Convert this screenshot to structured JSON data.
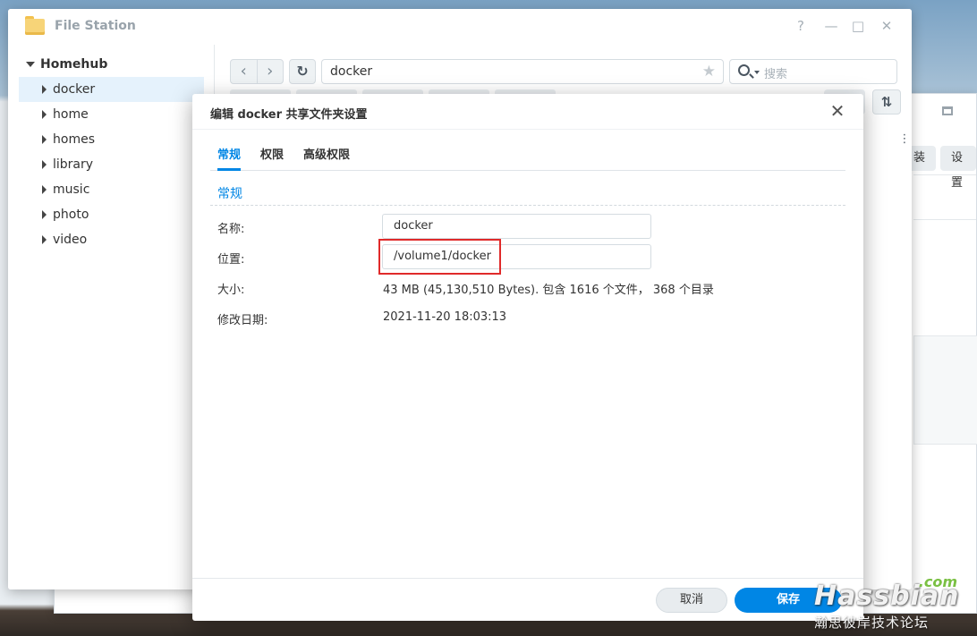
{
  "background_window": {
    "button_left": "装",
    "button_settings": "设置"
  },
  "file_station": {
    "title": "File Station",
    "window_controls": {
      "help": "?",
      "minimize": "—",
      "maximize": "□",
      "close": "✕"
    },
    "tree": {
      "root": "Homehub",
      "items": [
        {
          "label": "docker",
          "selected": true
        },
        {
          "label": "home"
        },
        {
          "label": "homes"
        },
        {
          "label": "library"
        },
        {
          "label": "music"
        },
        {
          "label": "photo"
        },
        {
          "label": "video"
        }
      ]
    },
    "toolbar": {
      "back": "‹",
      "forward": "›",
      "refresh": "↻",
      "path": "docker",
      "star": "★",
      "search_placeholder": "搜索",
      "sort": "⇅",
      "more": "⋮"
    }
  },
  "dialog": {
    "title": "编辑 docker 共享文件夹设置",
    "close": "✕",
    "tabs": [
      "常规",
      "权限",
      "高级权限"
    ],
    "active_tab": 0,
    "section_title": "常规",
    "fields": {
      "name_label": "名称:",
      "name_value": "docker",
      "location_label": "位置:",
      "location_value": "/volume1/docker",
      "size_label": "大小:",
      "size_value": "43 MB (45,130,510 Bytes). 包含 1616 个文件， 368 个目录",
      "modified_label": "修改日期:",
      "modified_value": "2021-11-20 18:03:13"
    },
    "cancel_label": "取消",
    "save_label": "保存"
  },
  "watermark": {
    "brand": "Hassbian",
    "suffix": ".com",
    "tagline": "瀚思彼岸技术论坛"
  },
  "colors": {
    "accent": "#0086e5",
    "highlight": "#e02a2a",
    "selected_row": "#e5f2fc"
  }
}
